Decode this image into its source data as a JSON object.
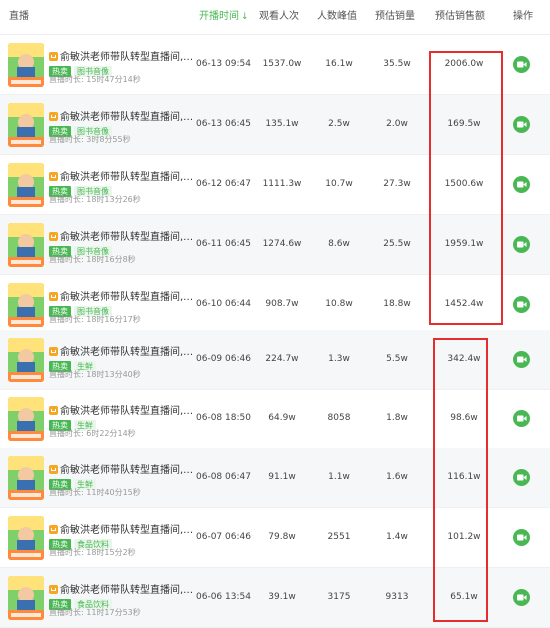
{
  "header": {
    "col_broadcast": "直播",
    "col_start_time": "开播时间",
    "col_viewers": "观看人次",
    "col_peak": "人数峰值",
    "col_est_sales": "预估销量",
    "col_est_revenue": "预估销售额",
    "col_action": "操作",
    "sort_glyph": "↓"
  },
  "colors": {
    "accent": "#49b854",
    "highlight": "#e52d2d",
    "cart": "#f5a623"
  },
  "rows": [
    {
      "title": "俞敏洪老师带队转型直播间,…",
      "hot": "热卖",
      "category": "图书音像",
      "duration": "直播时长: 15时47分14秒",
      "start": "06-13 09:54",
      "viewers": "1537.0w",
      "peak": "16.1w",
      "sales": "35.5w",
      "revenue": "2006.0w"
    },
    {
      "title": "俞敏洪老师带队转型直播间,…",
      "hot": "热卖",
      "category": "图书音像",
      "duration": "直播时长: 3时8分55秒",
      "start": "06-13 06:45",
      "viewers": "135.1w",
      "peak": "2.5w",
      "sales": "2.0w",
      "revenue": "169.5w"
    },
    {
      "title": "俞敏洪老师带队转型直播间,…",
      "hot": "热卖",
      "category": "图书音像",
      "duration": "直播时长: 18时13分26秒",
      "start": "06-12 06:47",
      "viewers": "1111.3w",
      "peak": "10.7w",
      "sales": "27.3w",
      "revenue": "1500.6w"
    },
    {
      "title": "俞敏洪老师带队转型直播间,…",
      "hot": "热卖",
      "category": "图书音像",
      "duration": "直播时长: 18时16分8秒",
      "start": "06-11 06:45",
      "viewers": "1274.6w",
      "peak": "8.6w",
      "sales": "25.5w",
      "revenue": "1959.1w"
    },
    {
      "title": "俞敏洪老师带队转型直播间,…",
      "hot": "热卖",
      "category": "图书音像",
      "duration": "直播时长: 18时16分17秒",
      "start": "06-10 06:44",
      "viewers": "908.7w",
      "peak": "10.8w",
      "sales": "18.8w",
      "revenue": "1452.4w"
    },
    {
      "title": "俞敏洪老师带队转型直播间,…",
      "hot": "热卖",
      "category": "生鲜",
      "duration": "直播时长: 18时13分40秒",
      "start": "06-09 06:46",
      "viewers": "224.7w",
      "peak": "1.3w",
      "sales": "5.5w",
      "revenue": "342.4w"
    },
    {
      "title": "俞敏洪老师带队转型直播间,…",
      "hot": "热卖",
      "category": "生鲜",
      "duration": "直播时长: 6时22分14秒",
      "start": "06-08 18:50",
      "viewers": "64.9w",
      "peak": "8058",
      "sales": "1.8w",
      "revenue": "98.6w"
    },
    {
      "title": "俞敏洪老师带队转型直播间,…",
      "hot": "热卖",
      "category": "生鲜",
      "duration": "直播时长: 11时40分15秒",
      "start": "06-08 06:47",
      "viewers": "91.1w",
      "peak": "1.1w",
      "sales": "1.6w",
      "revenue": "116.1w"
    },
    {
      "title": "俞敏洪老师带队转型直播间,…",
      "hot": "热卖",
      "category": "食品饮料",
      "duration": "直播时长: 18时15分2秒",
      "start": "06-07 06:46",
      "viewers": "79.8w",
      "peak": "2551",
      "sales": "1.4w",
      "revenue": "101.2w"
    },
    {
      "title": "俞敏洪老师带队转型直播间,…",
      "hot": "热卖",
      "category": "食品饮料",
      "duration": "直播时长: 11时17分53秒",
      "start": "06-06 13:54",
      "viewers": "39.1w",
      "peak": "3175",
      "sales": "9313",
      "revenue": "65.1w"
    }
  ]
}
